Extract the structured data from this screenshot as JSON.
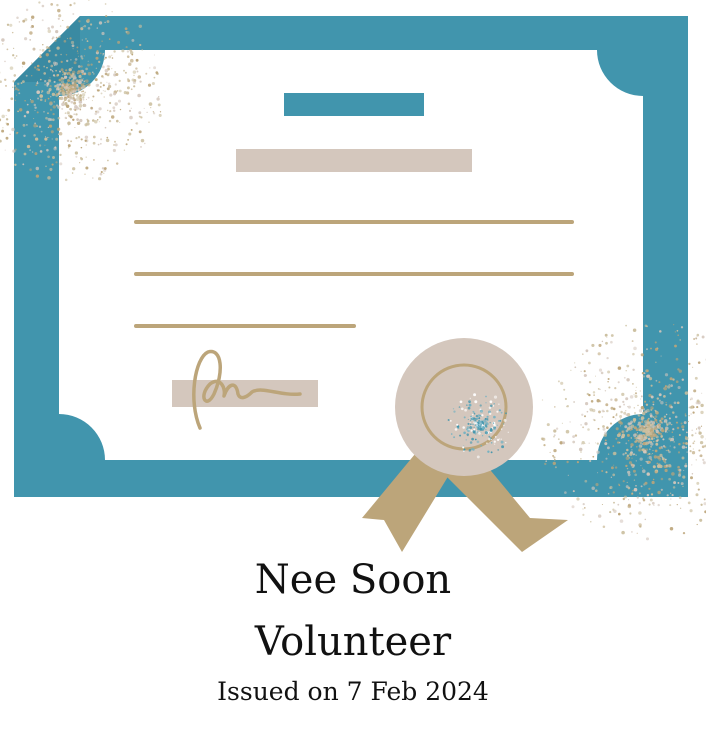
{
  "certificate": {
    "title_line1": "Nee Soon",
    "title_line2": "Volunteer",
    "issued": "Issued on 7 Feb 2024"
  },
  "icons": {
    "certificate": "certificate-icon",
    "badge": "award-ribbon-icon",
    "signature": "signature-icon"
  },
  "colors": {
    "border_teal": "#4195ad",
    "paper": "#ffffff",
    "gold": "#bca57a",
    "beige": "#d4c7bd",
    "text": "#111111"
  }
}
